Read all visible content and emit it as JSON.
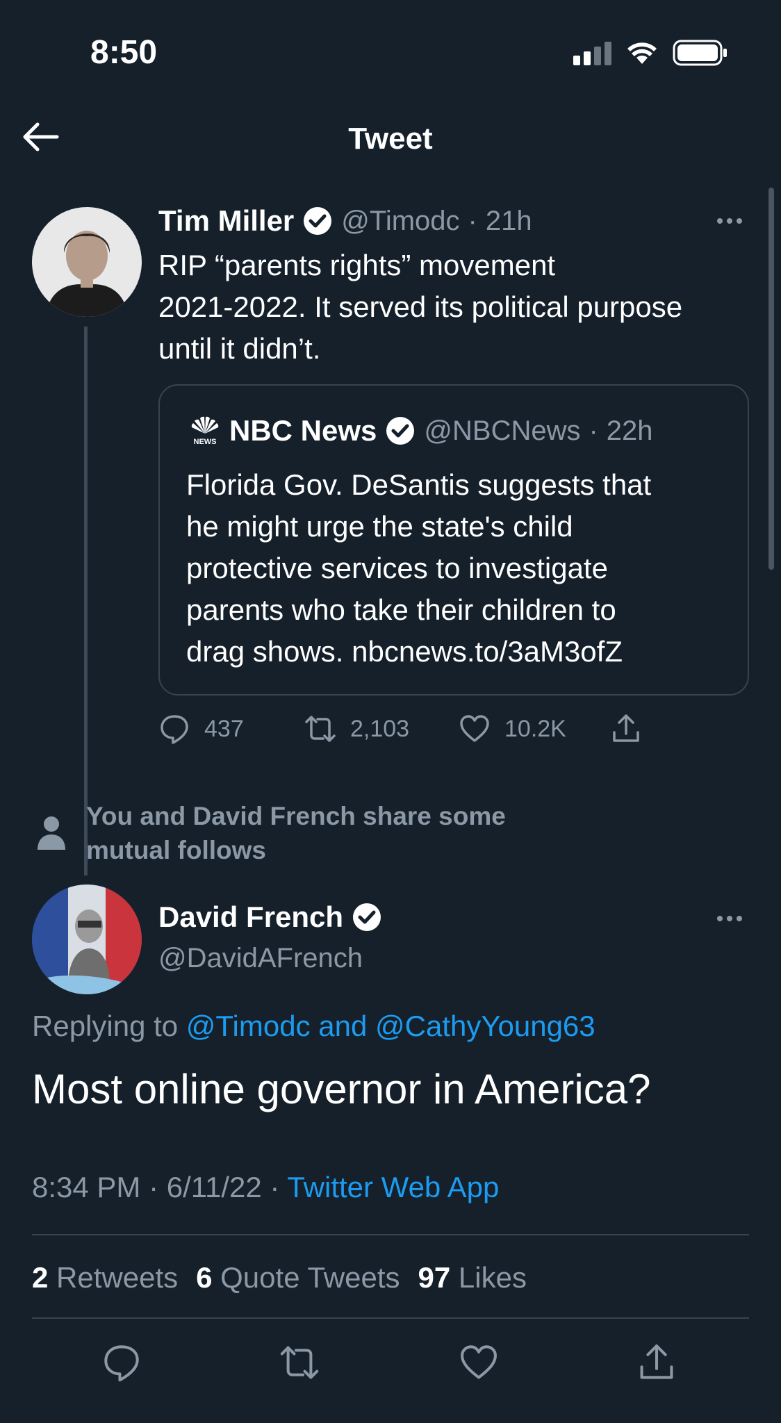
{
  "status_bar": {
    "time": "8:50"
  },
  "header": {
    "title": "Tweet"
  },
  "parent_tweet": {
    "author_name": "Tim Miller",
    "handle": "@Timodc",
    "time_sep": "·",
    "time": "21h",
    "text_lines": [
      "RIP “parents rights” movement",
      "2021-2022. It served its political purpose",
      "until it didn’t."
    ],
    "quote": {
      "source_name": "NBC News",
      "handle": "@NBCNews",
      "time_sep": "·",
      "time": "22h",
      "logo_text": "NEWS",
      "text_lines": [
        "Florida Gov. DeSantis suggests that",
        "he might urge the state's child",
        "protective services to investigate",
        "parents who take their children to",
        "drag shows. nbcnews.to/3aM3ofZ"
      ]
    },
    "actions": {
      "replies": "437",
      "retweets": "2,103",
      "likes": "10.2K"
    }
  },
  "mutual": {
    "line1": "You and David French share some",
    "line2": "mutual follows"
  },
  "main_tweet": {
    "author_name": "David French",
    "handle": "@DavidAFrench",
    "replying_prefix": "Replying to ",
    "replying_to": "@Timodc and @CathyYoung63",
    "text": "Most online governor in America?",
    "timestamp": "8:34 PM · 6/11/22 · ",
    "source_app": "Twitter Web App",
    "stats": [
      {
        "count": "2",
        "label": "Retweets"
      },
      {
        "count": "6",
        "label": "Quote Tweets"
      },
      {
        "count": "97",
        "label": "Likes"
      }
    ]
  },
  "colors": {
    "background": "#15202b",
    "accent": "#1d9bf0",
    "secondary_text": "#8b98a5",
    "border": "#38444d"
  }
}
